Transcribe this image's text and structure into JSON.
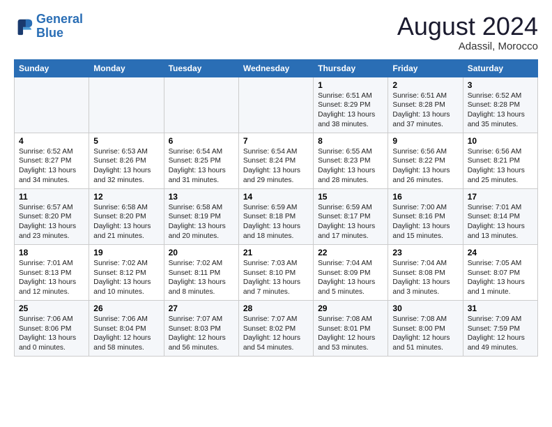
{
  "logo": {
    "line1": "General",
    "line2": "Blue"
  },
  "title": "August 2024",
  "subtitle": "Adassil, Morocco",
  "days": [
    "Sunday",
    "Monday",
    "Tuesday",
    "Wednesday",
    "Thursday",
    "Friday",
    "Saturday"
  ],
  "weeks": [
    [
      {
        "date": "",
        "sunrise": "",
        "sunset": "",
        "daylight": ""
      },
      {
        "date": "",
        "sunrise": "",
        "sunset": "",
        "daylight": ""
      },
      {
        "date": "",
        "sunrise": "",
        "sunset": "",
        "daylight": ""
      },
      {
        "date": "",
        "sunrise": "",
        "sunset": "",
        "daylight": ""
      },
      {
        "date": "1",
        "sunrise": "Sunrise: 6:51 AM",
        "sunset": "Sunset: 8:29 PM",
        "daylight": "Daylight: 13 hours and 38 minutes."
      },
      {
        "date": "2",
        "sunrise": "Sunrise: 6:51 AM",
        "sunset": "Sunset: 8:28 PM",
        "daylight": "Daylight: 13 hours and 37 minutes."
      },
      {
        "date": "3",
        "sunrise": "Sunrise: 6:52 AM",
        "sunset": "Sunset: 8:28 PM",
        "daylight": "Daylight: 13 hours and 35 minutes."
      }
    ],
    [
      {
        "date": "4",
        "sunrise": "Sunrise: 6:52 AM",
        "sunset": "Sunset: 8:27 PM",
        "daylight": "Daylight: 13 hours and 34 minutes."
      },
      {
        "date": "5",
        "sunrise": "Sunrise: 6:53 AM",
        "sunset": "Sunset: 8:26 PM",
        "daylight": "Daylight: 13 hours and 32 minutes."
      },
      {
        "date": "6",
        "sunrise": "Sunrise: 6:54 AM",
        "sunset": "Sunset: 8:25 PM",
        "daylight": "Daylight: 13 hours and 31 minutes."
      },
      {
        "date": "7",
        "sunrise": "Sunrise: 6:54 AM",
        "sunset": "Sunset: 8:24 PM",
        "daylight": "Daylight: 13 hours and 29 minutes."
      },
      {
        "date": "8",
        "sunrise": "Sunrise: 6:55 AM",
        "sunset": "Sunset: 8:23 PM",
        "daylight": "Daylight: 13 hours and 28 minutes."
      },
      {
        "date": "9",
        "sunrise": "Sunrise: 6:56 AM",
        "sunset": "Sunset: 8:22 PM",
        "daylight": "Daylight: 13 hours and 26 minutes."
      },
      {
        "date": "10",
        "sunrise": "Sunrise: 6:56 AM",
        "sunset": "Sunset: 8:21 PM",
        "daylight": "Daylight: 13 hours and 25 minutes."
      }
    ],
    [
      {
        "date": "11",
        "sunrise": "Sunrise: 6:57 AM",
        "sunset": "Sunset: 8:20 PM",
        "daylight": "Daylight: 13 hours and 23 minutes."
      },
      {
        "date": "12",
        "sunrise": "Sunrise: 6:58 AM",
        "sunset": "Sunset: 8:20 PM",
        "daylight": "Daylight: 13 hours and 21 minutes."
      },
      {
        "date": "13",
        "sunrise": "Sunrise: 6:58 AM",
        "sunset": "Sunset: 8:19 PM",
        "daylight": "Daylight: 13 hours and 20 minutes."
      },
      {
        "date": "14",
        "sunrise": "Sunrise: 6:59 AM",
        "sunset": "Sunset: 8:18 PM",
        "daylight": "Daylight: 13 hours and 18 minutes."
      },
      {
        "date": "15",
        "sunrise": "Sunrise: 6:59 AM",
        "sunset": "Sunset: 8:17 PM",
        "daylight": "Daylight: 13 hours and 17 minutes."
      },
      {
        "date": "16",
        "sunrise": "Sunrise: 7:00 AM",
        "sunset": "Sunset: 8:16 PM",
        "daylight": "Daylight: 13 hours and 15 minutes."
      },
      {
        "date": "17",
        "sunrise": "Sunrise: 7:01 AM",
        "sunset": "Sunset: 8:14 PM",
        "daylight": "Daylight: 13 hours and 13 minutes."
      }
    ],
    [
      {
        "date": "18",
        "sunrise": "Sunrise: 7:01 AM",
        "sunset": "Sunset: 8:13 PM",
        "daylight": "Daylight: 13 hours and 12 minutes."
      },
      {
        "date": "19",
        "sunrise": "Sunrise: 7:02 AM",
        "sunset": "Sunset: 8:12 PM",
        "daylight": "Daylight: 13 hours and 10 minutes."
      },
      {
        "date": "20",
        "sunrise": "Sunrise: 7:02 AM",
        "sunset": "Sunset: 8:11 PM",
        "daylight": "Daylight: 13 hours and 8 minutes."
      },
      {
        "date": "21",
        "sunrise": "Sunrise: 7:03 AM",
        "sunset": "Sunset: 8:10 PM",
        "daylight": "Daylight: 13 hours and 7 minutes."
      },
      {
        "date": "22",
        "sunrise": "Sunrise: 7:04 AM",
        "sunset": "Sunset: 8:09 PM",
        "daylight": "Daylight: 13 hours and 5 minutes."
      },
      {
        "date": "23",
        "sunrise": "Sunrise: 7:04 AM",
        "sunset": "Sunset: 8:08 PM",
        "daylight": "Daylight: 13 hours and 3 minutes."
      },
      {
        "date": "24",
        "sunrise": "Sunrise: 7:05 AM",
        "sunset": "Sunset: 8:07 PM",
        "daylight": "Daylight: 13 hours and 1 minute."
      }
    ],
    [
      {
        "date": "25",
        "sunrise": "Sunrise: 7:06 AM",
        "sunset": "Sunset: 8:06 PM",
        "daylight": "Daylight: 13 hours and 0 minutes."
      },
      {
        "date": "26",
        "sunrise": "Sunrise: 7:06 AM",
        "sunset": "Sunset: 8:04 PM",
        "daylight": "Daylight: 12 hours and 58 minutes."
      },
      {
        "date": "27",
        "sunrise": "Sunrise: 7:07 AM",
        "sunset": "Sunset: 8:03 PM",
        "daylight": "Daylight: 12 hours and 56 minutes."
      },
      {
        "date": "28",
        "sunrise": "Sunrise: 7:07 AM",
        "sunset": "Sunset: 8:02 PM",
        "daylight": "Daylight: 12 hours and 54 minutes."
      },
      {
        "date": "29",
        "sunrise": "Sunrise: 7:08 AM",
        "sunset": "Sunset: 8:01 PM",
        "daylight": "Daylight: 12 hours and 53 minutes."
      },
      {
        "date": "30",
        "sunrise": "Sunrise: 7:08 AM",
        "sunset": "Sunset: 8:00 PM",
        "daylight": "Daylight: 12 hours and 51 minutes."
      },
      {
        "date": "31",
        "sunrise": "Sunrise: 7:09 AM",
        "sunset": "Sunset: 7:59 PM",
        "daylight": "Daylight: 12 hours and 49 minutes."
      }
    ]
  ]
}
